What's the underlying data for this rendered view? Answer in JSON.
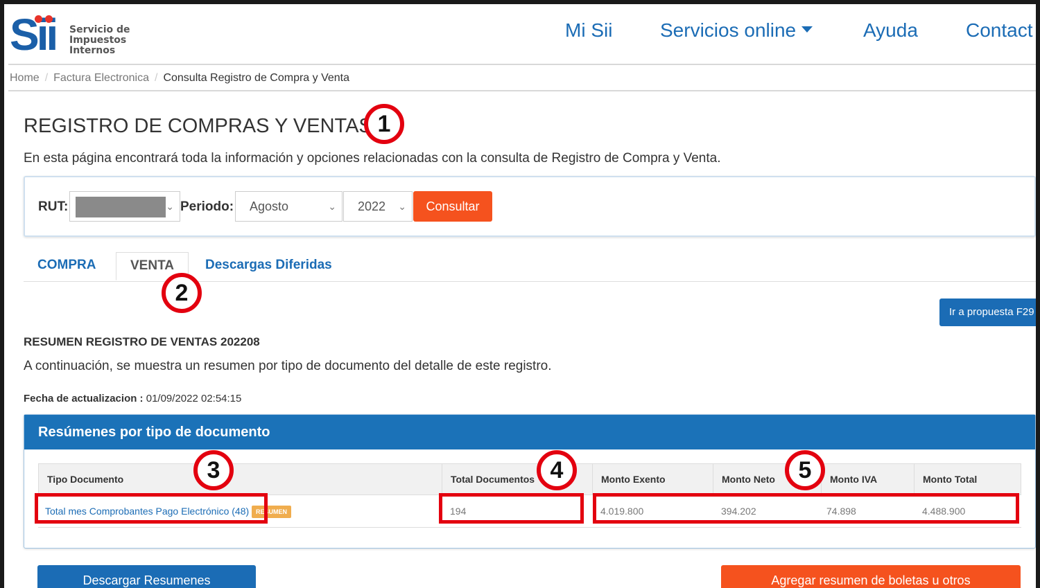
{
  "header": {
    "logo_lines": [
      "Servicio de",
      "Impuestos",
      "Internos"
    ],
    "nav": {
      "mi_sii": "Mi Sii",
      "servicios": "Servicios online",
      "ayuda": "Ayuda",
      "contacto": "Contact"
    }
  },
  "breadcrumb": {
    "home": "Home",
    "factura": "Factura Electronica",
    "current": "Consulta Registro de Compra y Venta"
  },
  "page": {
    "title": "REGISTRO DE COMPRAS Y VENTAS",
    "intro": "En esta página encontrará toda la información y opciones relacionadas con la consulta de Registro de Compra y Venta."
  },
  "form": {
    "rut_label": "RUT:",
    "periodo_label": "Periodo:",
    "month": "Agosto",
    "year": "2022",
    "consultar": "Consultar"
  },
  "tabs": {
    "compra": "COMPRA",
    "venta": "VENTA",
    "descargas": "Descargas Diferidas"
  },
  "f29_button": "Ir a propuesta F29",
  "resumen": {
    "title": "RESUMEN REGISTRO DE VENTAS 202208",
    "description": "A continuación, se muestra un resumen por tipo de documento del detalle de este registro.",
    "fecha_label": "Fecha de actualizacion :",
    "fecha_value": "01/09/2022 02:54:15"
  },
  "table": {
    "panel_title": "Resúmenes por tipo de documento",
    "headers": {
      "tipo": "Tipo Documento",
      "total_docs": "Total Documentos",
      "exento": "Monto Exento",
      "neto": "Monto Neto",
      "iva": "Monto IVA",
      "total": "Monto Total"
    },
    "row": {
      "tipo": "Total mes Comprobantes Pago Electrónico (48)",
      "badge": "RESUMEN",
      "total_docs": "194",
      "exento": "4.019.800",
      "neto": "394.202",
      "iva": "74.898",
      "total": "4.488.900"
    }
  },
  "actions": {
    "descargar": "Descargar Resumenes",
    "agregar": "Agregar resumen de boletas u otros"
  },
  "annotations": {
    "n1": "1",
    "n2": "2",
    "n3": "3",
    "n4": "4",
    "n5": "5"
  },
  "colors": {
    "primary_blue": "#1b6cb5",
    "accent_orange": "#f5521e",
    "annotation_red": "#e3000f"
  }
}
